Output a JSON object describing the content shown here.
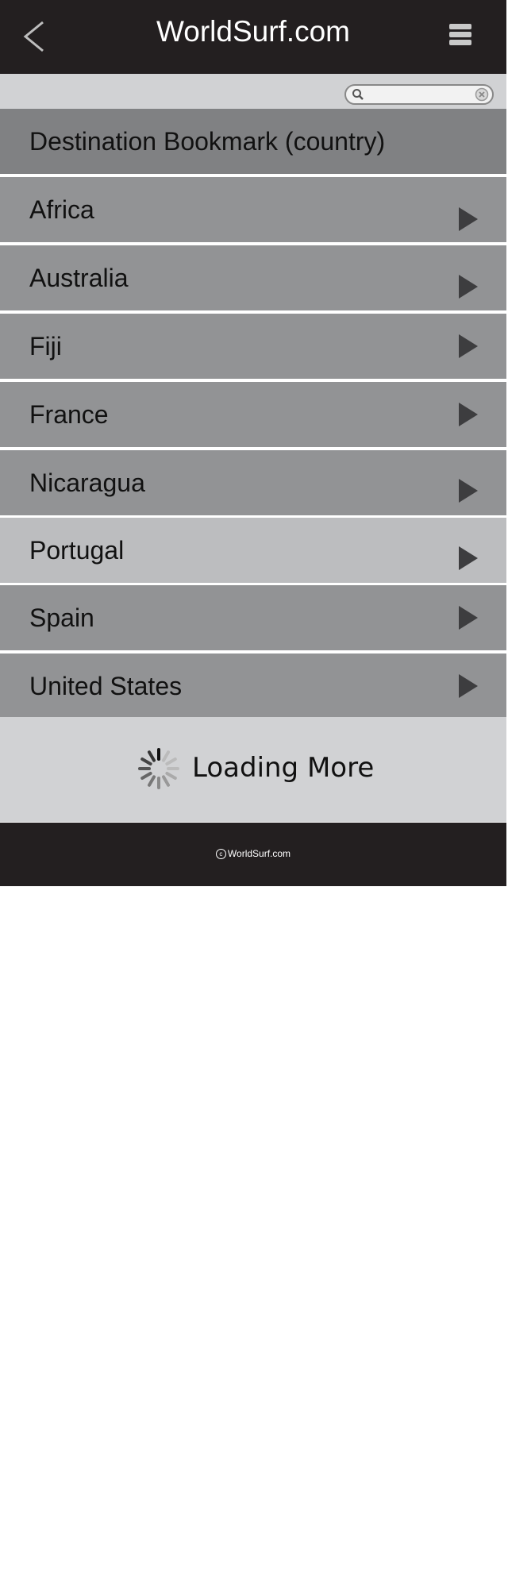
{
  "header": {
    "title": "WorldSurf.com",
    "back_icon": "chevron-left-icon",
    "menu_icon": "hamburger-menu-icon"
  },
  "search": {
    "value": "",
    "placeholder": "",
    "search_icon": "search-icon",
    "clear_icon": "clear-icon"
  },
  "list": {
    "heading": "Destination Bookmark (country)",
    "items": [
      {
        "label": "Africa",
        "selected": false
      },
      {
        "label": "Australia",
        "selected": false
      },
      {
        "label": "Fiji",
        "selected": false
      },
      {
        "label": "France",
        "selected": false
      },
      {
        "label": "Nicaragua",
        "selected": false
      },
      {
        "label": "Portugal",
        "selected": true
      },
      {
        "label": "Spain",
        "selected": false
      },
      {
        "label": "United States",
        "selected": false
      }
    ],
    "item_icon": "chevron-right-icon"
  },
  "loading": {
    "text": "Loading More",
    "icon": "spinner-icon"
  },
  "footer": {
    "copyright_symbol": "c",
    "text": "WorldSurf.com"
  },
  "colors": {
    "header_bg": "#231f20",
    "row_bg": "#929395",
    "heading_row_bg": "#808183",
    "selected_row_bg": "#bcbdbf",
    "panel_bg": "#d1d2d4"
  }
}
